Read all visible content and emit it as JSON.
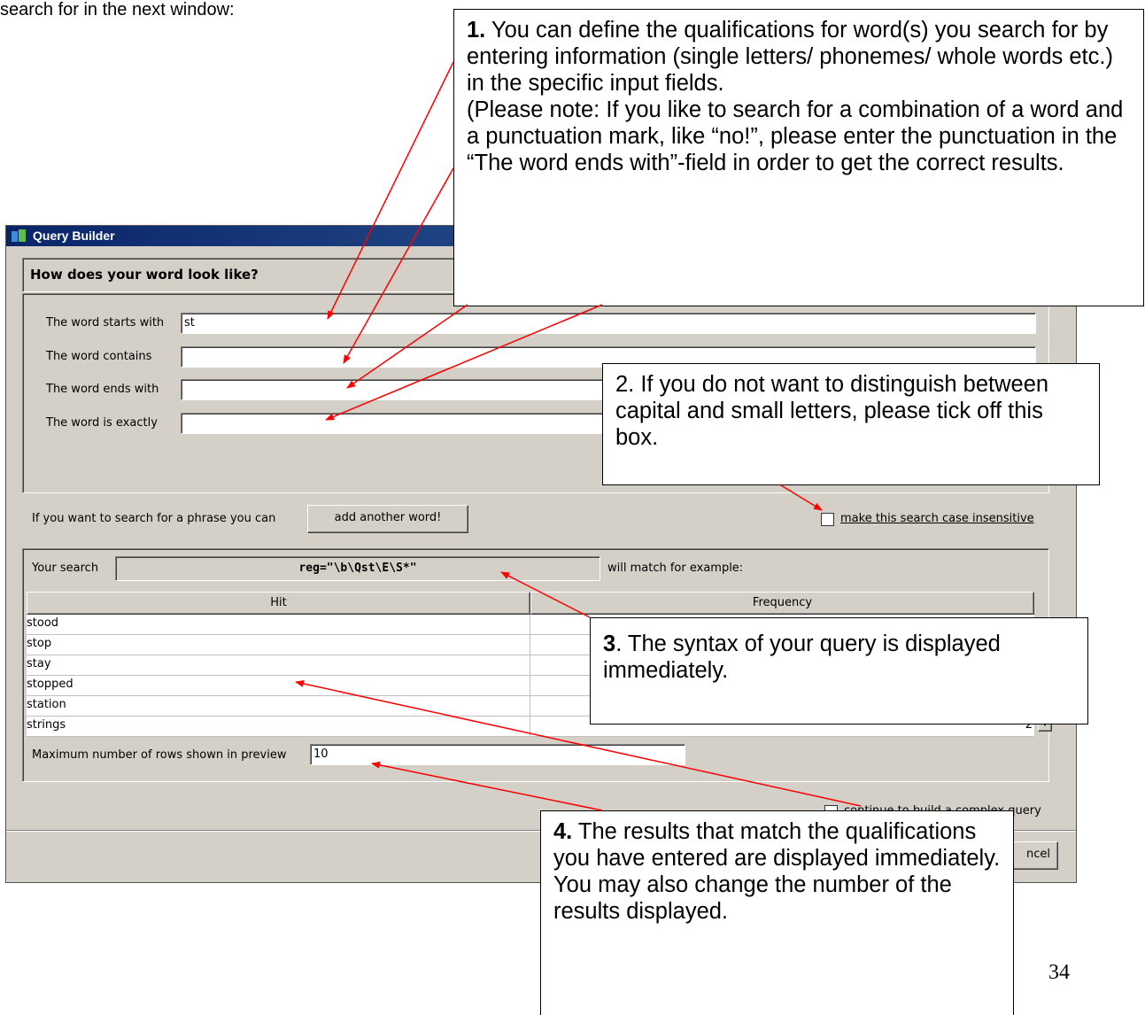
{
  "intro_text": "search for in the next window:",
  "page_number": "34",
  "dialog": {
    "title": "Query Builder",
    "section_heading": "How does your word look like?",
    "fields": [
      {
        "label": "The word starts with",
        "value": "st"
      },
      {
        "label": "The word contains",
        "value": ""
      },
      {
        "label": "The word ends with",
        "value": ""
      },
      {
        "label": "The word is exactly",
        "value": ""
      }
    ],
    "phrase_label": "If you want to search for a phrase you can",
    "add_word_button": "add another word!",
    "case_checkbox_label": "make this search case insensitive",
    "your_search_label": "Your search",
    "search_syntax": "reg=\"\\b\\Qst\\E\\S*\"",
    "match_label": "will match for example:",
    "table": {
      "headers": [
        "Hit",
        "Frequency"
      ],
      "rows": [
        {
          "hit": "stood",
          "freq": ""
        },
        {
          "hit": "stop",
          "freq": ""
        },
        {
          "hit": "stay",
          "freq": ""
        },
        {
          "hit": "stopped",
          "freq": ""
        },
        {
          "hit": "station",
          "freq": ""
        },
        {
          "hit": "strings",
          "freq": "2"
        }
      ]
    },
    "max_rows_label": "Maximum number of rows shown in preview",
    "max_rows_value": "10",
    "complex_query_label": "continue to build a complex query",
    "cancel_button_partial": "ncel"
  },
  "callouts": {
    "c1_num": "1.",
    "c1_text": "You can define the qualifications for word(s) you search for by entering information (single letters/ phonemes/ whole words etc.) in the specific input fields.",
    "c1_note": "(Please note: If you like to search for a combination of a word and a punctuation mark, like “no!”, please enter the punctuation in the “The word ends with”-field in order to get the correct results.",
    "c2_text": "2. If  you do not want to distinguish between capital and small letters, please tick off this box.",
    "c3_num": "3",
    "c3_text": ". The syntax of your query is displayed immediately.",
    "c4_num": "4.",
    "c4_text": "The results that match the qualifications you have entered are displayed immediately.",
    "c4_text2": "You may also change the number of the results displayed."
  },
  "colors": {
    "arrow": "#ff0000",
    "titlebar": "#0a246a"
  }
}
